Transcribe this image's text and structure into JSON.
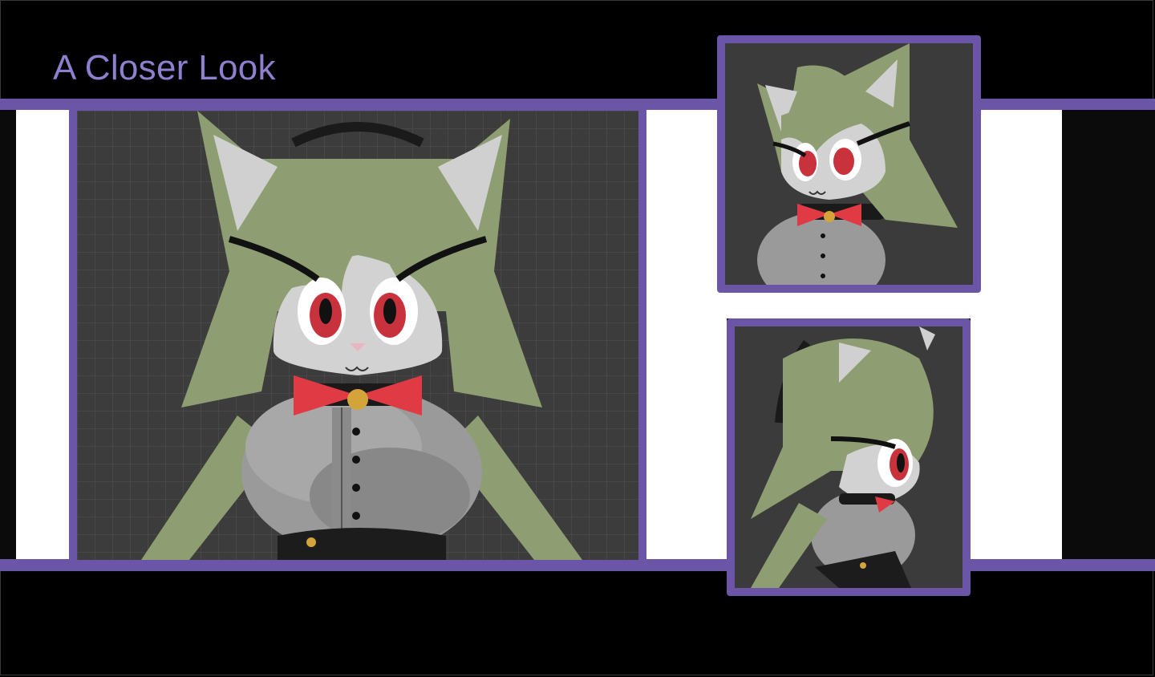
{
  "page": {
    "title": "A Closer Look"
  },
  "colors": {
    "accent_purple": "#6a55a6",
    "title_purple": "#8f7fcf",
    "background": "#000000",
    "panel_bg": "#3b3b3b",
    "fur_green": "#8e9e72",
    "face_gray": "#d2d2d2",
    "eye_red": "#c8323c",
    "bow_red": "#e03a44",
    "shirt_gray": "#9a9a9a"
  },
  "images": {
    "main": {
      "icon": "character-front-render"
    },
    "top_right": {
      "icon": "character-three-quarter-render"
    },
    "bottom_right": {
      "icon": "character-side-render"
    }
  }
}
